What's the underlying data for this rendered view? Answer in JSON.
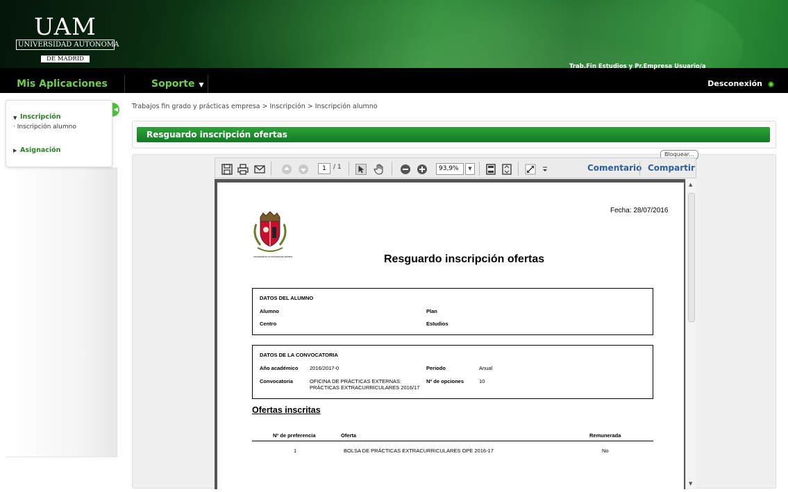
{
  "header": {
    "logo": {
      "line1": "UAM",
      "line2": "UNIVERSIDAD AUTONOMA",
      "line3": "DE MADRID"
    },
    "user_label": "Trab.Fin Estudios y Pr.Empresa Usuario/a"
  },
  "nav": {
    "apps": "Mis Aplicaciones",
    "support": "Soporte",
    "logout": "Desconexión"
  },
  "sidebar": {
    "sections": [
      {
        "label": "Inscripción",
        "expanded": true,
        "items": [
          "· Inscripción alumno"
        ]
      },
      {
        "label": "Asignación",
        "expanded": false,
        "items": []
      }
    ]
  },
  "breadcrumb": "Trabajos fin grado y prácticas empresa > Inscripción > Inscripción alumno",
  "page_title": "Resguardo inscripción ofertas",
  "viewer": {
    "lock_label": "Bloquear...",
    "current_page": "1",
    "total_pages": "/ 1",
    "zoom": "93,9%",
    "comment_label": "Comentario",
    "share_label": "Compartir"
  },
  "document": {
    "date": "Fecha: 28/07/2016",
    "title": "Resguardo inscripción ofertas",
    "crest_caption": "UNIVERSIDAD AUTONOMA DE MADRID",
    "student": {
      "heading": "DATOS DEL ALUMNO",
      "alumno_label": "Alumno",
      "plan_label": "Plan",
      "centro_label": "Centro",
      "estudios_label": "Estudios"
    },
    "convocatoria": {
      "heading": "DATOS DE LA CONVOCATORIA",
      "year_label": "Año académico",
      "year_value": "2016/2017-0",
      "period_label": "Periodo",
      "period_value": "Anual",
      "conv_label": "Convocatoria",
      "conv_value_1": "OFICINA DE PRÁCTICAS EXTERNAS:",
      "conv_value_2": "PRÁCTICAS EXTRACURRICULARES 2016/17",
      "options_label": "Nº de opciones",
      "options_value": "10"
    },
    "offers": {
      "heading": "Ofertas inscritas",
      "columns": [
        "Nº de preferencia",
        "Oferta",
        "Remunerada"
      ],
      "rows": [
        {
          "pref": "1",
          "oferta": "BOLSA DE PRÁCTICAS EXTRACURRICULARES OPE 2016-17",
          "remunerada": "No"
        }
      ]
    }
  }
}
